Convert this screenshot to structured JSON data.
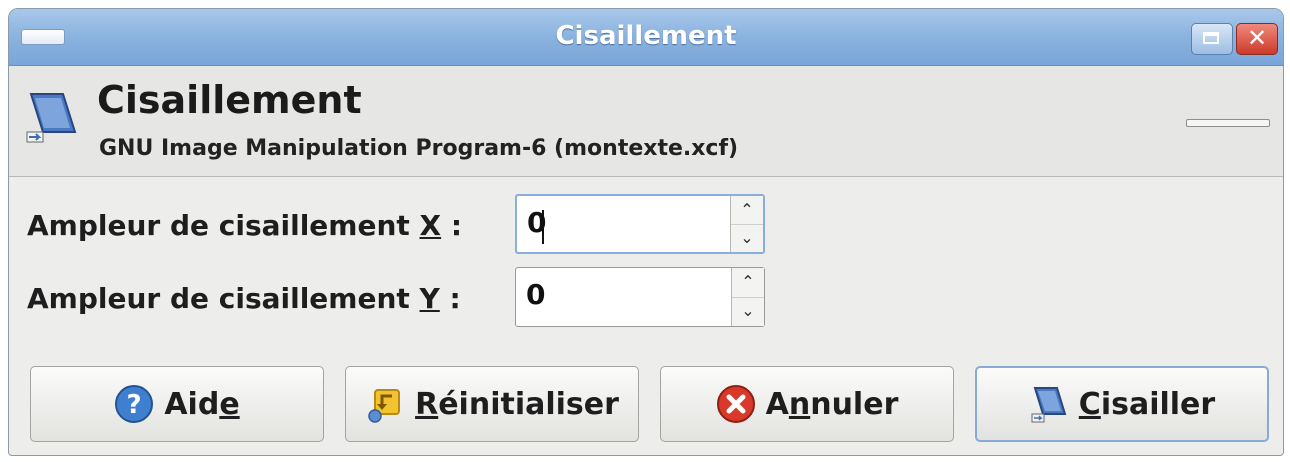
{
  "window": {
    "title": "Cisaillement"
  },
  "header": {
    "title": "Cisaillement",
    "subtitle": "GNU Image Manipulation Program-6 (montexte.xcf)"
  },
  "form": {
    "x_label_pre": "Ampleur de cisaillement ",
    "x_label_key": "X",
    "x_label_post": " :",
    "x_value": "0",
    "y_label_pre": "Ampleur de cisaillement ",
    "y_label_key": "Y",
    "y_label_post": " :",
    "y_value": "0"
  },
  "buttons": {
    "help_pre": "Aid",
    "help_key": "e",
    "reset_key": "R",
    "reset_post": "éinitialiser",
    "cancel_pre": "A",
    "cancel_key": "n",
    "cancel_post": "nuler",
    "shear_key": "C",
    "shear_post": "isailler"
  },
  "icons": {
    "help": "help-icon",
    "reset": "reset-icon",
    "cancel": "cancel-icon",
    "shear": "shear-tool-icon",
    "header": "shear-tool-icon"
  },
  "colors": {
    "titlebar": "#8db4e0",
    "close": "#cc3a2a",
    "default_button_border": "#88aad6"
  }
}
